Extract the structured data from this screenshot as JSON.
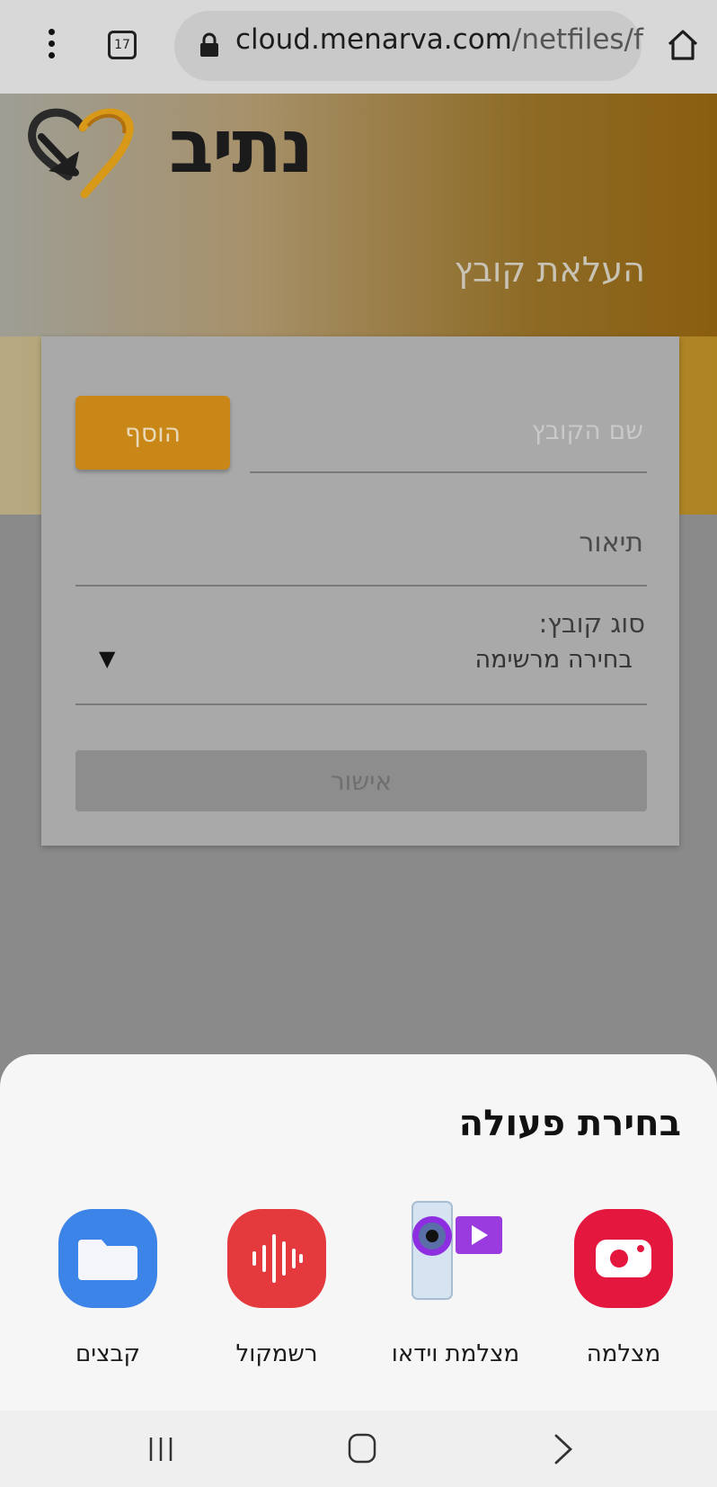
{
  "browser": {
    "tab_count": "17",
    "url_host": "cloud.menarva.com",
    "url_path": "/netfiles/f"
  },
  "header": {
    "logo_text": "נתיב",
    "title": "העלאת קובץ"
  },
  "form": {
    "filename_placeholder": "שם הקובץ",
    "add_label": "הוסף",
    "description_label": "תיאור",
    "file_type_label": "סוג קובץ:",
    "file_type_selected": "בחירה מרשימה",
    "confirm_label": "אישור"
  },
  "action_sheet": {
    "title": "בחירת פעולה",
    "apps": [
      {
        "label": "קבצים",
        "icon": "files-icon"
      },
      {
        "label": "רשמקול",
        "icon": "voice-recorder-icon"
      },
      {
        "label": "מצלמת וידאו",
        "icon": "video-camera-icon"
      },
      {
        "label": "מצלמה",
        "icon": "camera-icon"
      }
    ]
  },
  "colors": {
    "accent": "#c98718",
    "files": "#3c84e8",
    "recorder": "#e43a3e",
    "camera": "#e4173f"
  }
}
